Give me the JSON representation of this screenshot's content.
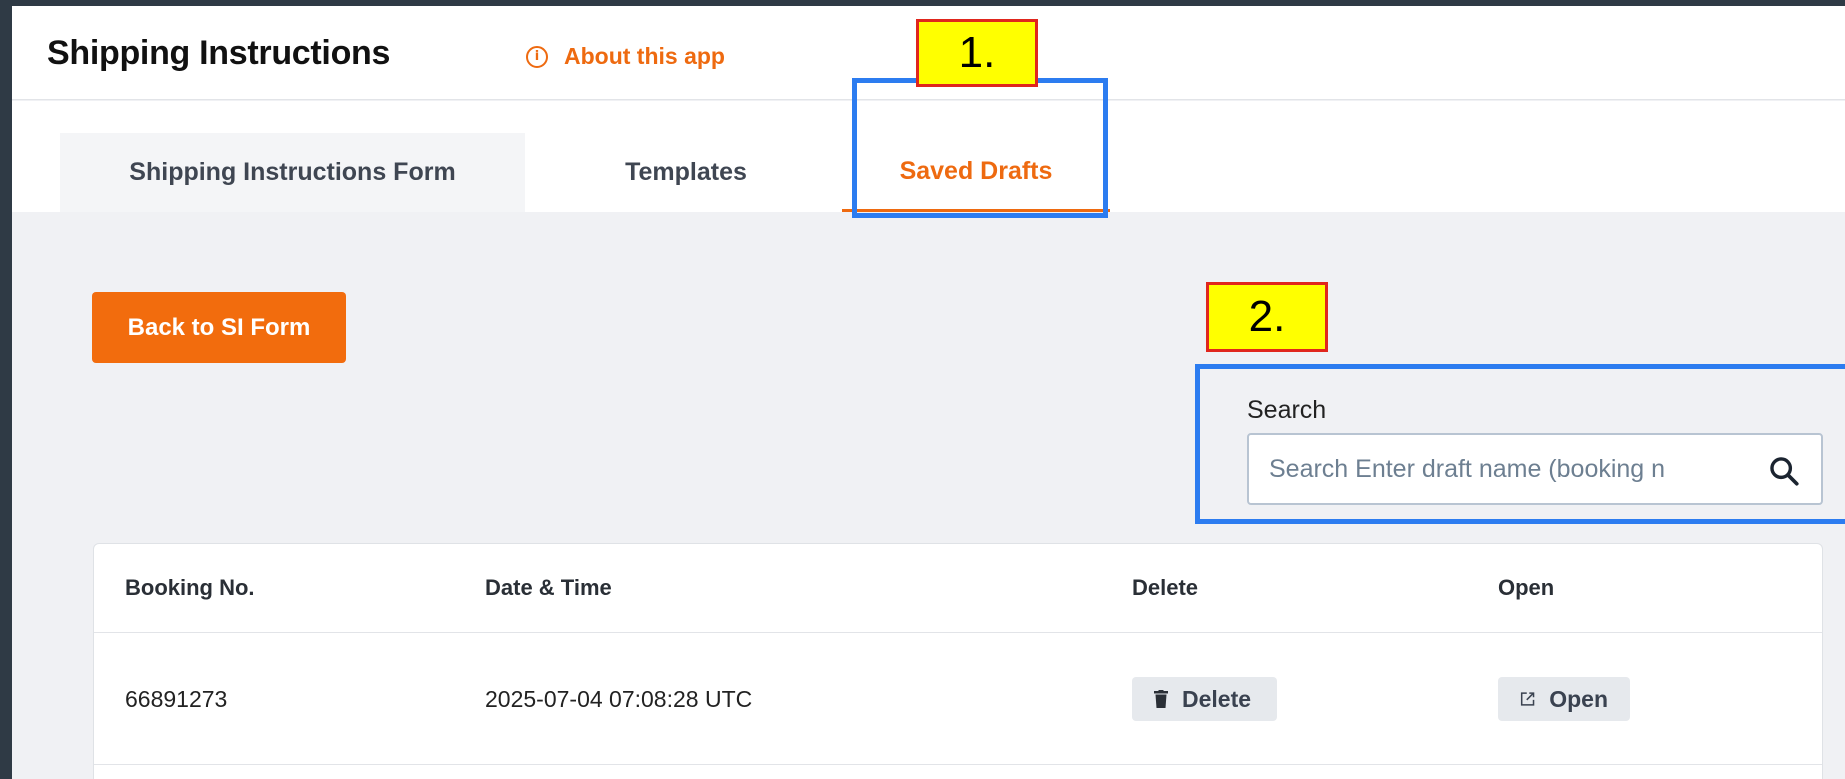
{
  "header": {
    "title": "Shipping Instructions",
    "about_label": "About this app",
    "about_icon": "info-circle-icon"
  },
  "tabs": [
    {
      "label": "Shipping Instructions Form",
      "active": false
    },
    {
      "label": "Templates",
      "active": false
    },
    {
      "label": "Saved Drafts",
      "active": true
    }
  ],
  "actions": {
    "back_label": "Back to SI Form"
  },
  "search": {
    "label": "Search",
    "placeholder": "Search Enter draft name (booking n",
    "icon": "search-icon"
  },
  "table": {
    "columns": [
      "Booking No.",
      "Date & Time",
      "Delete",
      "Open"
    ],
    "rows": [
      {
        "booking_no": "66891273",
        "datetime": "2025-07-04 07:08:28 UTC",
        "delete_label": "Delete",
        "open_label": "Open"
      }
    ]
  },
  "annotations": [
    {
      "label": "1."
    },
    {
      "label": "2."
    }
  ],
  "colors": {
    "accent": "#ee6a10",
    "annotation_box": "#2c7cf0",
    "annotation_label_bg": "#ffff00",
    "annotation_label_border": "#e0261d"
  }
}
